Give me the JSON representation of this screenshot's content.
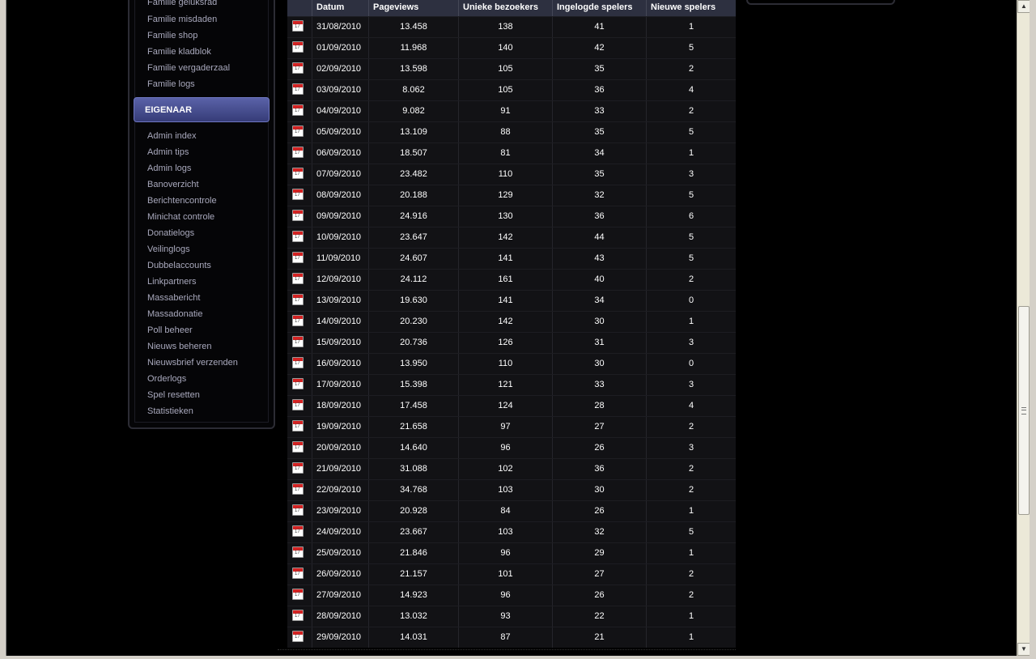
{
  "sidebar": {
    "family_links": [
      "Familie geluksrad",
      "Familie misdaden",
      "Familie shop",
      "Familie kladblok",
      "Familie vergaderzaal",
      "Familie logs"
    ],
    "section_title": "EIGENAAR",
    "owner_links": [
      "Admin index",
      "Admin tips",
      "Admin logs",
      "Banoverzicht",
      "Berichtencontrole",
      "Minichat controle",
      "Donatielogs",
      "Veilinglogs",
      "Dubbelaccounts",
      "Linkpartners",
      "Massabericht",
      "Massadonatie",
      "Poll beheer",
      "Nieuws beheren",
      "Nieuwsbrief verzenden",
      "Orderlogs",
      "Spel resetten",
      "Statistieken"
    ]
  },
  "table": {
    "headers": [
      "Datum",
      "Pageviews",
      "Unieke bezoekers",
      "Ingelogde spelers",
      "Nieuwe spelers"
    ],
    "rows": [
      [
        "31/08/2010",
        "13.458",
        "138",
        "41",
        "1"
      ],
      [
        "01/09/2010",
        "11.968",
        "140",
        "42",
        "5"
      ],
      [
        "02/09/2010",
        "13.598",
        "105",
        "35",
        "2"
      ],
      [
        "03/09/2010",
        "8.062",
        "105",
        "36",
        "4"
      ],
      [
        "04/09/2010",
        "9.082",
        "91",
        "33",
        "2"
      ],
      [
        "05/09/2010",
        "13.109",
        "88",
        "35",
        "5"
      ],
      [
        "06/09/2010",
        "18.507",
        "81",
        "34",
        "1"
      ],
      [
        "07/09/2010",
        "23.482",
        "110",
        "35",
        "3"
      ],
      [
        "08/09/2010",
        "20.188",
        "129",
        "32",
        "5"
      ],
      [
        "09/09/2010",
        "24.916",
        "130",
        "36",
        "6"
      ],
      [
        "10/09/2010",
        "23.647",
        "142",
        "44",
        "5"
      ],
      [
        "11/09/2010",
        "24.607",
        "141",
        "43",
        "5"
      ],
      [
        "12/09/2010",
        "24.112",
        "161",
        "40",
        "2"
      ],
      [
        "13/09/2010",
        "19.630",
        "141",
        "34",
        "0"
      ],
      [
        "14/09/2010",
        "20.230",
        "142",
        "30",
        "1"
      ],
      [
        "15/09/2010",
        "20.736",
        "126",
        "31",
        "3"
      ],
      [
        "16/09/2010",
        "13.950",
        "110",
        "30",
        "0"
      ],
      [
        "17/09/2010",
        "15.398",
        "121",
        "33",
        "3"
      ],
      [
        "18/09/2010",
        "17.458",
        "124",
        "28",
        "4"
      ],
      [
        "19/09/2010",
        "21.658",
        "97",
        "27",
        "2"
      ],
      [
        "20/09/2010",
        "14.640",
        "96",
        "26",
        "3"
      ],
      [
        "21/09/2010",
        "31.088",
        "102",
        "36",
        "2"
      ],
      [
        "22/09/2010",
        "34.768",
        "103",
        "30",
        "2"
      ],
      [
        "23/09/2010",
        "20.928",
        "84",
        "26",
        "1"
      ],
      [
        "24/09/2010",
        "23.667",
        "103",
        "32",
        "5"
      ],
      [
        "25/09/2010",
        "21.846",
        "96",
        "29",
        "1"
      ],
      [
        "26/09/2010",
        "21.157",
        "101",
        "27",
        "2"
      ],
      [
        "27/09/2010",
        "14.923",
        "96",
        "26",
        "2"
      ],
      [
        "28/09/2010",
        "13.032",
        "93",
        "22",
        "1"
      ],
      [
        "29/09/2010",
        "14.031",
        "87",
        "21",
        "1"
      ]
    ]
  },
  "icons": {
    "row_icon": "calendar-icon"
  },
  "colors": {
    "section_header": "#4a519a",
    "table_header": "#2d3040",
    "row_background": "#121215"
  }
}
